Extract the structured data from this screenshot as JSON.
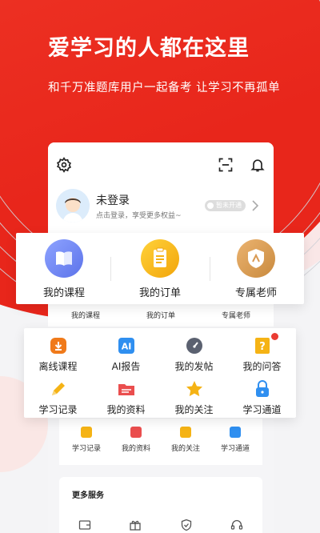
{
  "hero": {
    "title": "爱学习的人都在这里",
    "subtitle": "和千万准题库用户一起备考 让学习不再孤单"
  },
  "profile": {
    "name": "未登录",
    "hint": "点击登录，享受更多权益~",
    "vip_badge": "暂未开通"
  },
  "main_features": [
    {
      "label": "我的课程",
      "icon": "book-icon",
      "color": "#6f87f1"
    },
    {
      "label": "我的订单",
      "icon": "order-icon",
      "color": "#f7b21f"
    },
    {
      "label": "专属老师",
      "icon": "teacher-badge-icon",
      "color": "#d99a54"
    }
  ],
  "main_features_small": [
    "我的课程",
    "我的订单",
    "专属老师"
  ],
  "grid": [
    {
      "label": "离线课程",
      "icon": "download-icon",
      "color": "#f07a1a"
    },
    {
      "label": "AI报告",
      "icon": "ai-icon",
      "color": "#2f8ff0"
    },
    {
      "label": "我的发帖",
      "icon": "gauge-icon",
      "color": "#5b6170"
    },
    {
      "label": "我的问答",
      "icon": "question-icon",
      "color": "#f5b315"
    },
    {
      "label": "学习记录",
      "icon": "pencil-icon",
      "color": "#f5b315"
    },
    {
      "label": "我的资料",
      "icon": "folder-icon",
      "color": "#ea4e4e"
    },
    {
      "label": "我的关注",
      "icon": "star-icon",
      "color": "#f5b315"
    },
    {
      "label": "学习通道",
      "icon": "lock-icon",
      "color": "#2f8ff0"
    }
  ],
  "grid_small": [
    "学习记录",
    "我的资料",
    "我的关注",
    "学习通道"
  ],
  "more_services": {
    "title": "更多服务"
  },
  "colors": {
    "brand_red": "#e8261b"
  }
}
